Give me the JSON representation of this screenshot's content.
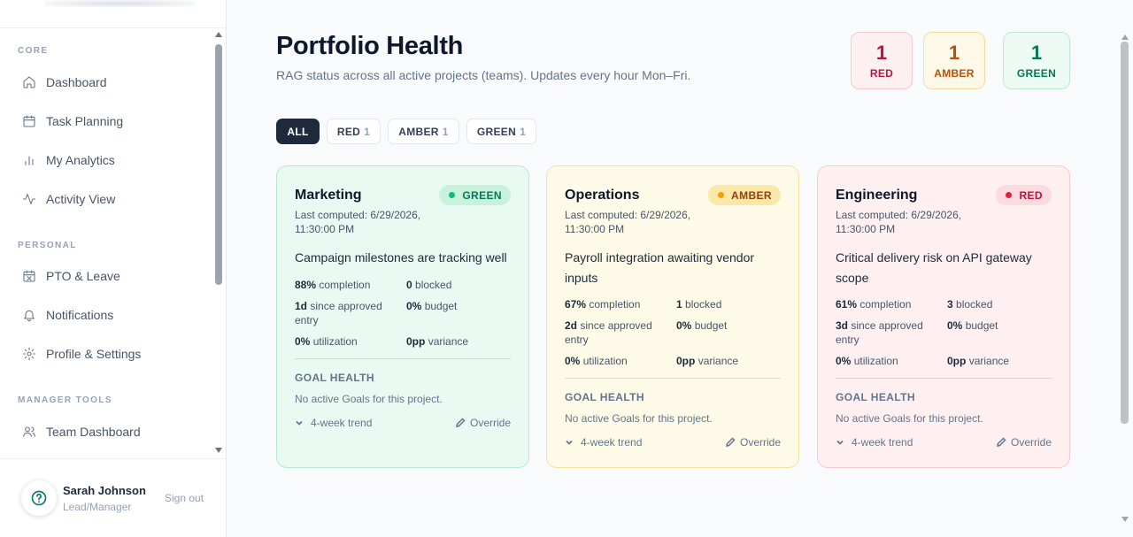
{
  "sidebar": {
    "sections": [
      {
        "label": "CORE"
      },
      {
        "label": "PERSONAL"
      },
      {
        "label": "MANAGER TOOLS"
      }
    ],
    "items": [
      {
        "label": "Dashboard",
        "icon": "home-icon"
      },
      {
        "label": "Task Planning",
        "icon": "calendar-icon"
      },
      {
        "label": "My Analytics",
        "icon": "bar-chart-icon"
      },
      {
        "label": "Activity View",
        "icon": "activity-icon"
      },
      {
        "label": "PTO & Leave",
        "icon": "calendar-off-icon"
      },
      {
        "label": "Notifications",
        "icon": "bell-icon"
      },
      {
        "label": "Profile & Settings",
        "icon": "gear-icon"
      },
      {
        "label": "Team Dashboard",
        "icon": "users-icon"
      }
    ],
    "user": {
      "name": "Sarah Johnson",
      "role": "Lead/Manager",
      "sign_out": "Sign out",
      "help_icon": "help-circle-icon"
    }
  },
  "header": {
    "title": "Portfolio Health",
    "subtitle": "RAG status across all active projects (teams). Updates every hour Mon–Fri."
  },
  "summary_counts": {
    "red": {
      "count": "1",
      "label": "RED"
    },
    "amber": {
      "count": "1",
      "label": "AMBER"
    },
    "green": {
      "count": "1",
      "label": "GREEN"
    }
  },
  "filters": [
    {
      "label": "ALL",
      "count": ""
    },
    {
      "label": "RED",
      "count": "1"
    },
    {
      "label": "AMBER",
      "count": "1"
    },
    {
      "label": "GREEN",
      "count": "1"
    }
  ],
  "colors": {
    "green": "#10b981",
    "amber": "#f59e0b",
    "red": "#e11d48",
    "dark": "#1e293b"
  },
  "cards": [
    {
      "title": "Marketing",
      "status": "GREEN",
      "computed": "Last computed: 6/29/2026, 11:30:00 PM",
      "summary": "Campaign milestones are tracking well",
      "completion_value": "88%",
      "completion_label": "completion",
      "blocked_value": "0",
      "blocked_label": "blocked",
      "since_value": "1d",
      "since_label": "since approved entry",
      "budget_value": "0%",
      "budget_label": "budget",
      "utilization_value": "0%",
      "utilization_label": "utilization",
      "variance_value": "0pp",
      "variance_label": "variance",
      "goal_title": "GOAL HEALTH",
      "goal_text": "No active Goals for this project.",
      "trend_label": "4-week trend",
      "override_label": "Override"
    },
    {
      "title": "Operations",
      "status": "AMBER",
      "computed": "Last computed: 6/29/2026, 11:30:00 PM",
      "summary": "Payroll integration awaiting vendor inputs",
      "completion_value": "67%",
      "completion_label": "completion",
      "blocked_value": "1",
      "blocked_label": "blocked",
      "since_value": "2d",
      "since_label": "since approved entry",
      "budget_value": "0%",
      "budget_label": "budget",
      "utilization_value": "0%",
      "utilization_label": "utilization",
      "variance_value": "0pp",
      "variance_label": "variance",
      "goal_title": "GOAL HEALTH",
      "goal_text": "No active Goals for this project.",
      "trend_label": "4-week trend",
      "override_label": "Override"
    },
    {
      "title": "Engineering",
      "status": "RED",
      "computed": "Last computed: 6/29/2026, 11:30:00 PM",
      "summary": "Critical delivery risk on API gateway scope",
      "completion_value": "61%",
      "completion_label": "completion",
      "blocked_value": "3",
      "blocked_label": "blocked",
      "since_value": "3d",
      "since_label": "since approved entry",
      "budget_value": "0%",
      "budget_label": "budget",
      "utilization_value": "0%",
      "utilization_label": "utilization",
      "variance_value": "0pp",
      "variance_label": "variance",
      "goal_title": "GOAL HEALTH",
      "goal_text": "No active Goals for this project.",
      "trend_label": "4-week trend",
      "override_label": "Override"
    }
  ]
}
